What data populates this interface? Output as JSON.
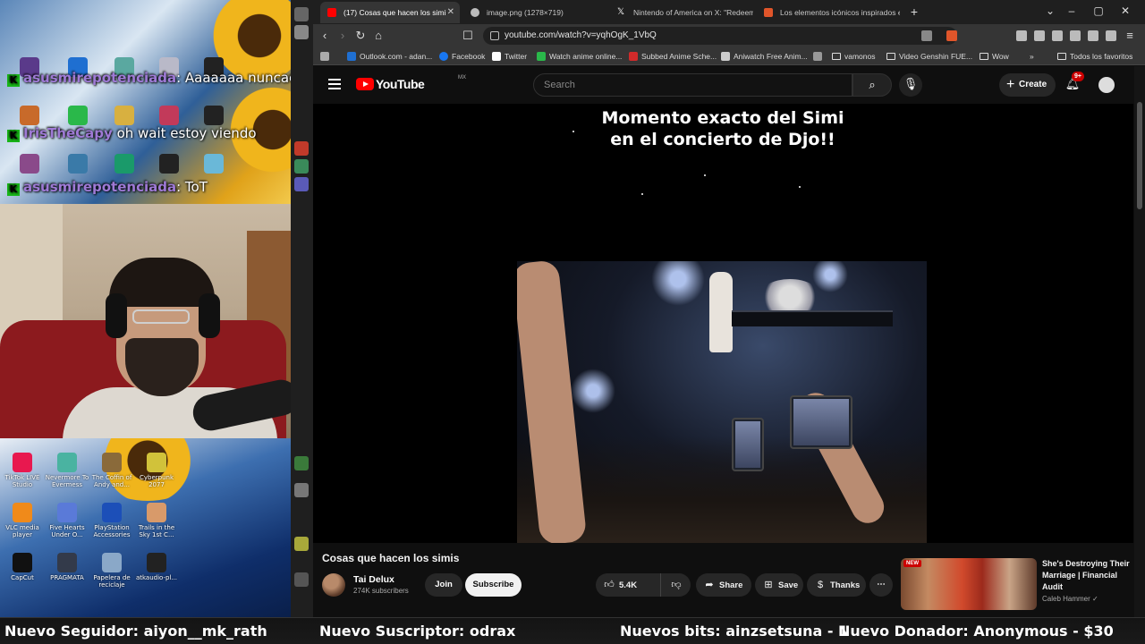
{
  "chat": [
    {
      "user": "asusmirepotenciada",
      "message": ": Aaaaaaa nuncae sale uno bonito"
    },
    {
      "user": "IrisTheCapy",
      "message": "oh wait estoy viendo"
    },
    {
      "user": "asusmirepotenciada",
      "message": ": ToT"
    }
  ],
  "desktop_icons": [
    {
      "label": "TikTok LIVE Studio",
      "color": "#e8184f"
    },
    {
      "label": "Nevermore To Evermess",
      "color": "#4ab3a1"
    },
    {
      "label": "The Coffin of Andy and...",
      "color": "#8a6a3a"
    },
    {
      "label": "Cyberpunk 2077",
      "color": "#d1c23a"
    },
    {
      "label": "VLC media player",
      "color": "#f08a1a"
    },
    {
      "label": "Five Hearts Under O...",
      "color": "#5a7ad8"
    },
    {
      "label": "PlayStation Accessories",
      "color": "#1c4fb8"
    },
    {
      "label": "Trails in the Sky 1st C...",
      "color": "#d89a6a"
    },
    {
      "label": "CapCut",
      "color": "#111111"
    },
    {
      "label": "PRAGMATA",
      "color": "#333a4a"
    },
    {
      "label": "Papelera de reciclaje",
      "color": "#8aa8c8"
    },
    {
      "label": "atkaudio-pl...",
      "color": "#222222"
    }
  ],
  "browser": {
    "tabs": [
      {
        "title": "(17) Cosas que hacen los simi",
        "active": true,
        "fav_color": "#ff0000"
      },
      {
        "title": "image.png (1278×719)",
        "active": false,
        "fav_color": "#bbbbbb"
      },
      {
        "title": "Nintendo of America on X: \"Redeem",
        "active": false,
        "fav_color": "#ffffff"
      },
      {
        "title": "Los elementos icónicos inspirados en",
        "active": false,
        "fav_color": "#e0552a"
      }
    ],
    "url": "youtube.com/watch?v=yqhOgK_1VbQ",
    "bookmarks": [
      {
        "label": "Outlook.com - adan...",
        "type": "site",
        "color": "#1f6fd1"
      },
      {
        "label": "Facebook",
        "type": "site",
        "color": "#1877f2"
      },
      {
        "label": "Twitter",
        "type": "site",
        "color": "#ffffff"
      },
      {
        "label": "Watch anime online...",
        "type": "site",
        "color": "#2ab84a"
      },
      {
        "label": "Subbed Anime Sche...",
        "type": "site",
        "color": "#d12a2a"
      },
      {
        "label": "Aniwatch Free Anim...",
        "type": "site",
        "color": "#cccccc"
      },
      {
        "label": "",
        "type": "site",
        "color": "#999999"
      },
      {
        "label": "vamonos",
        "type": "folder",
        "color": ""
      },
      {
        "label": "Video Genshin FUE...",
        "type": "folder",
        "color": ""
      },
      {
        "label": "Wow",
        "type": "folder",
        "color": ""
      }
    ],
    "all_bookmarks": "Todos los favoritos",
    "more": "»"
  },
  "youtube": {
    "logo": "YouTube",
    "country": "MX",
    "search_placeholder": "Search",
    "create": "Create",
    "notif_count": "9+",
    "video_caption": "Momento exacto del Simi en el concierto de Djo!!",
    "video_title": "Cosas que hacen los simis",
    "channel_name": "Tai Delux",
    "channel_subs": "274K subscribers",
    "join": "Join",
    "subscribe": "Subscribe",
    "likes": "5.4K",
    "share": "Share",
    "save": "Save",
    "thanks": "Thanks",
    "more": "⋯",
    "recommendation": {
      "badge": "NEW",
      "title": "She's Destroying Their Marriage | Financial Audit",
      "channel": "Caleb Hammer ✓"
    }
  },
  "ticker": [
    "Nuevo Seguidor: aiyon__mk_rath",
    "Nuevo Suscriptor: odrax",
    "Nuevos bits: ainzsetsuna - 1",
    "Nuevo Donador: Anonymous - $30"
  ],
  "colors": {
    "yt_red": "#ff0000",
    "chat_user": "#9f7ad6",
    "chat_badge": "#18b518"
  }
}
